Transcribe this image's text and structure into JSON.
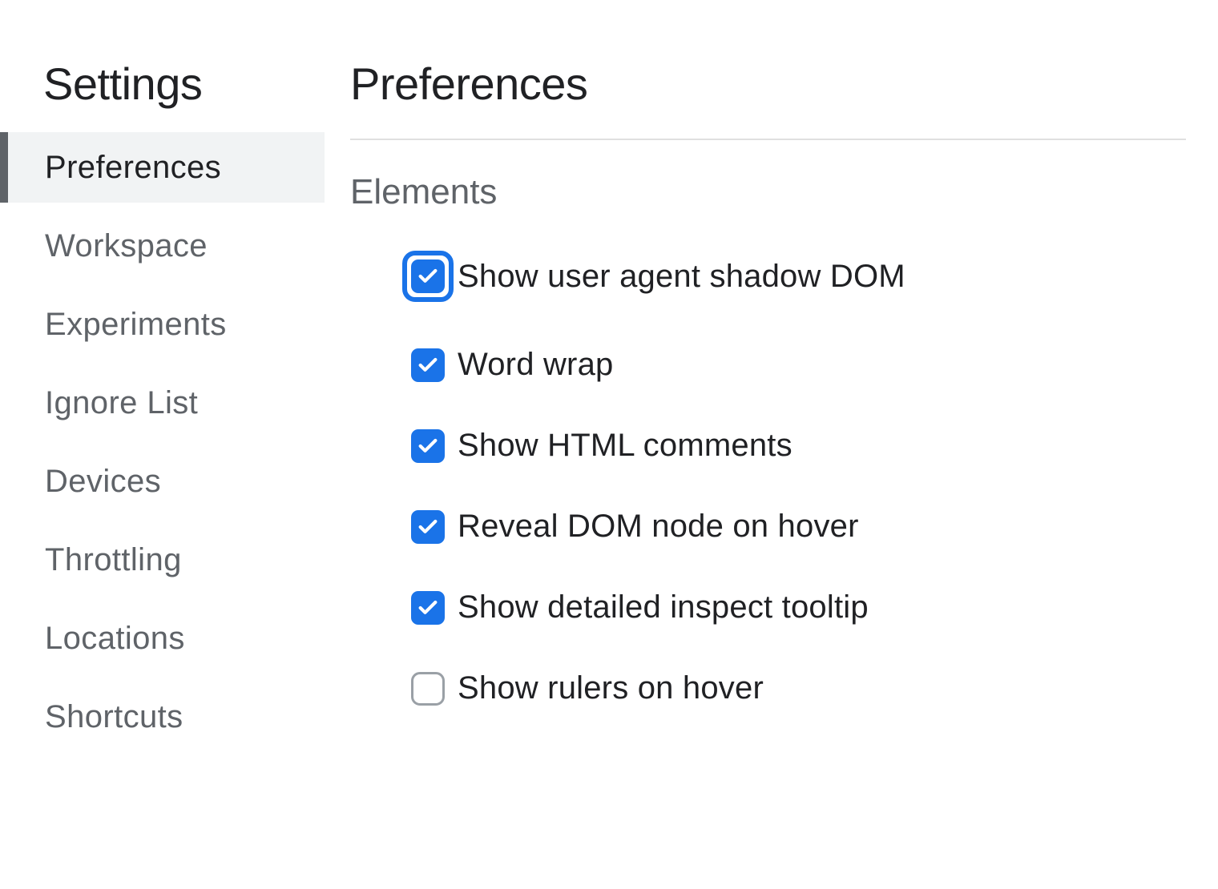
{
  "sidebar": {
    "title": "Settings",
    "items": [
      {
        "label": "Preferences",
        "selected": true
      },
      {
        "label": "Workspace",
        "selected": false
      },
      {
        "label": "Experiments",
        "selected": false
      },
      {
        "label": "Ignore List",
        "selected": false
      },
      {
        "label": "Devices",
        "selected": false
      },
      {
        "label": "Throttling",
        "selected": false
      },
      {
        "label": "Locations",
        "selected": false
      },
      {
        "label": "Shortcuts",
        "selected": false
      }
    ]
  },
  "main": {
    "title": "Preferences",
    "section": "Elements",
    "options": [
      {
        "label": "Show user agent shadow DOM",
        "checked": true,
        "focused": true
      },
      {
        "label": "Word wrap",
        "checked": true,
        "focused": false
      },
      {
        "label": "Show HTML comments",
        "checked": true,
        "focused": false
      },
      {
        "label": "Reveal DOM node on hover",
        "checked": true,
        "focused": false
      },
      {
        "label": "Show detailed inspect tooltip",
        "checked": true,
        "focused": false
      },
      {
        "label": "Show rulers on hover",
        "checked": false,
        "focused": false
      }
    ]
  }
}
